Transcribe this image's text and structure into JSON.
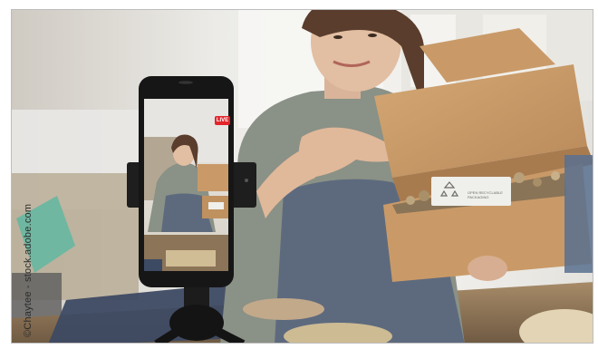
{
  "image": {
    "alt": "",
    "credit": "©Chaytee - stock.adobe.com",
    "badges": {
      "live_badge": "LIVE"
    },
    "box_label_line1": "OPEN RECYCLABLE",
    "box_label_line2": "PACKAGING",
    "colors": {
      "live_red": "#e3242b",
      "cardboard": "#c99a68",
      "apron": "#5d6a7e",
      "shirt": "#8a9186"
    }
  }
}
